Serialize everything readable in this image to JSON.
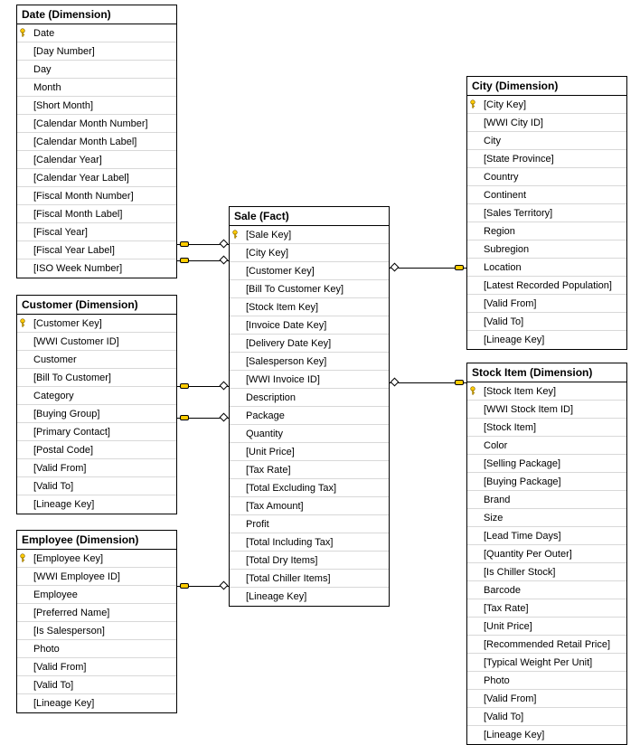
{
  "tables": {
    "date": {
      "title": "Date (Dimension)",
      "fields": [
        {
          "label": "Date",
          "pk": true
        },
        {
          "label": "[Day Number]"
        },
        {
          "label": "Day"
        },
        {
          "label": "Month"
        },
        {
          "label": "[Short Month]"
        },
        {
          "label": "[Calendar Month Number]"
        },
        {
          "label": "[Calendar Month Label]"
        },
        {
          "label": "[Calendar Year]"
        },
        {
          "label": "[Calendar Year Label]"
        },
        {
          "label": "[Fiscal Month Number]"
        },
        {
          "label": "[Fiscal Month Label]"
        },
        {
          "label": "[Fiscal Year]"
        },
        {
          "label": "[Fiscal Year Label]"
        },
        {
          "label": "[ISO Week Number]"
        }
      ]
    },
    "customer": {
      "title": "Customer (Dimension)",
      "fields": [
        {
          "label": "[Customer Key]",
          "pk": true
        },
        {
          "label": "[WWI Customer ID]"
        },
        {
          "label": "Customer"
        },
        {
          "label": "[Bill To Customer]"
        },
        {
          "label": "Category"
        },
        {
          "label": "[Buying Group]"
        },
        {
          "label": "[Primary Contact]"
        },
        {
          "label": "[Postal Code]"
        },
        {
          "label": "[Valid From]"
        },
        {
          "label": "[Valid To]"
        },
        {
          "label": "[Lineage Key]"
        }
      ]
    },
    "employee": {
      "title": "Employee (Dimension)",
      "fields": [
        {
          "label": "[Employee Key]",
          "pk": true
        },
        {
          "label": "[WWI Employee ID]"
        },
        {
          "label": "Employee"
        },
        {
          "label": "[Preferred Name]"
        },
        {
          "label": "[Is Salesperson]"
        },
        {
          "label": "Photo"
        },
        {
          "label": "[Valid From]"
        },
        {
          "label": "[Valid To]"
        },
        {
          "label": "[Lineage Key]"
        }
      ]
    },
    "sale": {
      "title": "Sale (Fact)",
      "fields": [
        {
          "label": "[Sale Key]",
          "pk": true
        },
        {
          "label": "[City Key]"
        },
        {
          "label": "[Customer Key]"
        },
        {
          "label": "[Bill To Customer Key]"
        },
        {
          "label": "[Stock Item Key]"
        },
        {
          "label": "[Invoice Date Key]"
        },
        {
          "label": "[Delivery Date Key]"
        },
        {
          "label": "[Salesperson Key]"
        },
        {
          "label": "[WWI Invoice ID]"
        },
        {
          "label": "Description"
        },
        {
          "label": "Package"
        },
        {
          "label": "Quantity"
        },
        {
          "label": "[Unit Price]"
        },
        {
          "label": "[Tax Rate]"
        },
        {
          "label": "[Total Excluding Tax]"
        },
        {
          "label": "[Tax Amount]"
        },
        {
          "label": "Profit"
        },
        {
          "label": "[Total Including Tax]"
        },
        {
          "label": "[Total Dry Items]"
        },
        {
          "label": "[Total Chiller Items]"
        },
        {
          "label": "[Lineage Key]"
        }
      ]
    },
    "city": {
      "title": "City (Dimension)",
      "fields": [
        {
          "label": "[City Key]",
          "pk": true
        },
        {
          "label": "[WWI City ID]"
        },
        {
          "label": "City"
        },
        {
          "label": "[State Province]"
        },
        {
          "label": "Country"
        },
        {
          "label": "Continent"
        },
        {
          "label": "[Sales Territory]"
        },
        {
          "label": "Region"
        },
        {
          "label": "Subregion"
        },
        {
          "label": "Location"
        },
        {
          "label": "[Latest Recorded Population]"
        },
        {
          "label": "[Valid From]"
        },
        {
          "label": "[Valid To]"
        },
        {
          "label": "[Lineage Key]"
        }
      ]
    },
    "stockitem": {
      "title": "Stock Item (Dimension)",
      "fields": [
        {
          "label": "[Stock Item Key]",
          "pk": true
        },
        {
          "label": "[WWI Stock Item ID]"
        },
        {
          "label": "[Stock Item]"
        },
        {
          "label": "Color"
        },
        {
          "label": "[Selling Package]"
        },
        {
          "label": "[Buying Package]"
        },
        {
          "label": "Brand"
        },
        {
          "label": "Size"
        },
        {
          "label": "[Lead Time Days]"
        },
        {
          "label": "[Quantity Per Outer]"
        },
        {
          "label": "[Is Chiller Stock]"
        },
        {
          "label": "Barcode"
        },
        {
          "label": "[Tax Rate]"
        },
        {
          "label": "[Unit Price]"
        },
        {
          "label": "[Recommended Retail Price]"
        },
        {
          "label": "[Typical Weight Per Unit]"
        },
        {
          "label": "Photo"
        },
        {
          "label": "[Valid From]"
        },
        {
          "label": "[Valid To]"
        },
        {
          "label": "[Lineage Key]"
        }
      ]
    }
  }
}
